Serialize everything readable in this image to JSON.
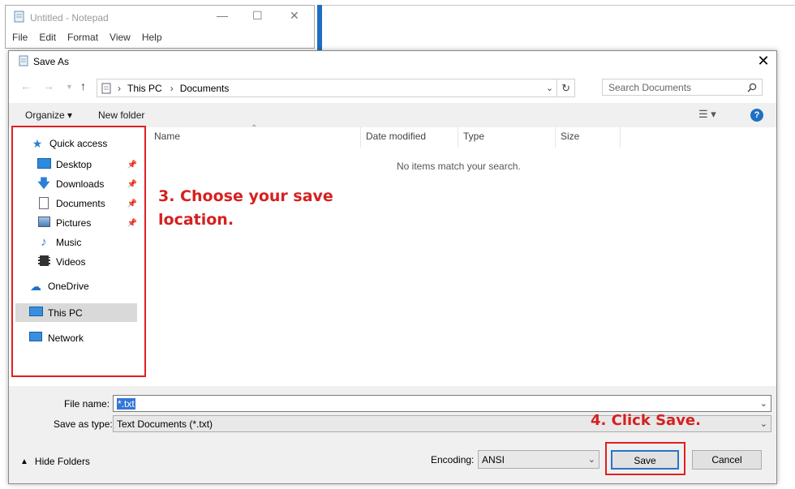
{
  "notepad": {
    "title": "Untitled - Notepad",
    "menu": [
      "File",
      "Edit",
      "Format",
      "View",
      "Help"
    ],
    "controls": {
      "minimize": "—",
      "maximize": "☐",
      "close": "✕"
    }
  },
  "dialog": {
    "title": "Save As",
    "close": "✕",
    "breadcrumb": [
      "This PC",
      "Documents"
    ],
    "search_placeholder": "Search Documents",
    "toolbar": {
      "organize": "Organize ▾",
      "new_folder": "New folder"
    },
    "nav_pane": {
      "quick_access": "Quick access",
      "items": [
        {
          "label": "Desktop",
          "icon": "desktop-icon",
          "pinned": true
        },
        {
          "label": "Downloads",
          "icon": "downloads-icon",
          "pinned": true
        },
        {
          "label": "Documents",
          "icon": "documents-icon",
          "pinned": true
        },
        {
          "label": "Pictures",
          "icon": "pictures-icon",
          "pinned": true
        },
        {
          "label": "Music",
          "icon": "music-icon",
          "pinned": false
        },
        {
          "label": "Videos",
          "icon": "videos-icon",
          "pinned": false
        }
      ],
      "onedrive": "OneDrive",
      "this_pc": "This PC",
      "network": "Network"
    },
    "columns": [
      "Name",
      "Date modified",
      "Type",
      "Size"
    ],
    "empty_message": "No items match your search.",
    "file_name_label": "File name:",
    "file_name_value": "*.txt",
    "save_as_type_label": "Save as type:",
    "save_as_type_value": "Text Documents (*.txt)",
    "hide_folders": "Hide Folders",
    "encoding_label": "Encoding:",
    "encoding_value": "ANSI",
    "save_button": "Save",
    "cancel_button": "Cancel"
  },
  "annotations": {
    "step3_line1": "3. Choose your save",
    "step3_line2": "location.",
    "step4": "4. Click Save."
  },
  "colors": {
    "accent": "#1f6fc4",
    "annotation_red": "#e02020",
    "selection": "#d9d9d9"
  }
}
